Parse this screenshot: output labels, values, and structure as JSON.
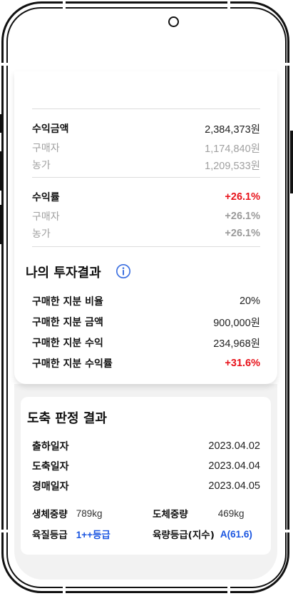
{
  "revenue": {
    "amount": {
      "label": "수익금액",
      "value": "2,384,373원"
    },
    "amount_buyer": {
      "label": "구매자",
      "value": "1,174,840원"
    },
    "amount_farmer": {
      "label": "농가",
      "value": "1,209,533원"
    },
    "rate": {
      "label": "수익률",
      "value": "+26.1%"
    },
    "rate_buyer": {
      "label": "구매자",
      "value": "+26.1%"
    },
    "rate_farmer": {
      "label": "농가",
      "value": "+26.1%"
    }
  },
  "investment": {
    "title": "나의 투자결과",
    "icon": "info-icon",
    "rows": [
      {
        "label": "구매한 지분 비율",
        "value": "20%"
      },
      {
        "label": "구매한 지분 금액",
        "value": "900,000원"
      },
      {
        "label": "구매한 지분 수익",
        "value": "234,968원"
      },
      {
        "label": "구매한 지분 수익률",
        "value": "+31.6%"
      }
    ]
  },
  "slaughter": {
    "title": "도축 판정 결과",
    "rows": [
      {
        "label": "출하일자",
        "value": "2023.04.02"
      },
      {
        "label": "도축일자",
        "value": "2023.04.04"
      },
      {
        "label": "경매일자",
        "value": "2023.04.05"
      }
    ],
    "live_weight": {
      "label": "생체중량",
      "value": "789kg"
    },
    "carcass_weight": {
      "label": "도체중량",
      "value": "469kg"
    },
    "quality_grade": {
      "label": "육질등급",
      "value": "1++등급"
    },
    "yield_grade": {
      "label": "육량등급(지수)",
      "value": "A(61.6)"
    }
  },
  "colors": {
    "accent_red": "#e8131b",
    "accent_blue": "#1a55e0",
    "info_icon": "#3b6fe0"
  }
}
